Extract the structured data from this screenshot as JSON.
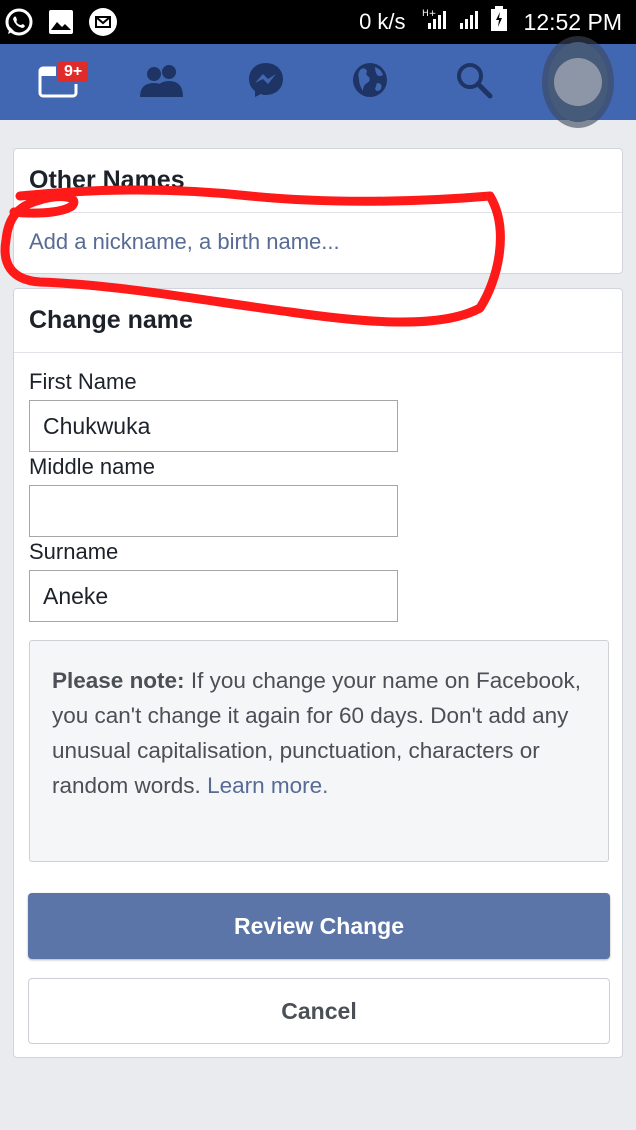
{
  "status_bar": {
    "icons": [
      "whatsapp-icon",
      "gallery-icon",
      "message-icon"
    ],
    "network_speed": "0 k/s",
    "network_type": "H+",
    "time": "12:52 PM"
  },
  "nav": {
    "notifications_badge": "9+",
    "items": [
      "notifications-icon",
      "friends-icon",
      "messenger-icon",
      "globe-icon",
      "search-icon",
      "menu-icon"
    ],
    "color": "#4267b2"
  },
  "other_names": {
    "title": "Other Names",
    "link": "Add a nickname, a birth name..."
  },
  "change_name": {
    "title": "Change name",
    "first_name_label": "First Name",
    "first_name_value": "Chukwuka",
    "middle_name_label": "Middle name",
    "middle_name_value": "",
    "surname_label": "Surname",
    "surname_value": "Aneke",
    "note_bold": "Please note:",
    "note_text": " If you change your name on Facebook, you can't change it again for 60 days. Don't add any unusual capitalisation, punctuation, characters or random words. ",
    "note_link": "Learn more.",
    "review_button": "Review Change",
    "cancel_button": "Cancel"
  },
  "colors": {
    "accent": "#4267b2",
    "button": "#5b75a9",
    "link": "#576b95",
    "annotation": "#ff1a1a"
  }
}
